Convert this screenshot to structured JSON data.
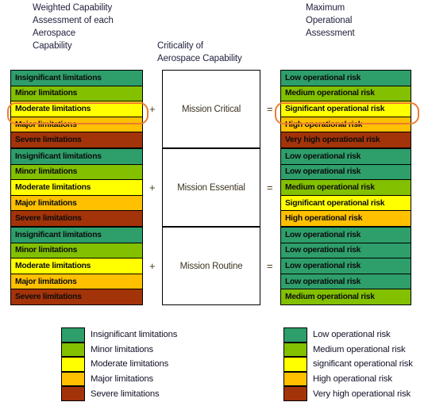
{
  "headings": {
    "left": "Weighted Capability\nAssessment of  each  Aerospace\nCapability",
    "middle": "Criticality of\nAerospace Capability",
    "right": "Maximum\nOperational\nAssessment"
  },
  "palette": {
    "green": "#2E9E6B",
    "yellow_green": "#82C000",
    "yellow": "#FFFF00",
    "amber": "#FFC000",
    "dark_red": "#A33309",
    "highlight_ring": "#ED7D31",
    "border": "#000000",
    "background": "#FFFFFF"
  },
  "operators": {
    "plus": "+",
    "equals": "="
  },
  "blocks": [
    {
      "criticality": "Mission Critical",
      "plus": "+",
      "equals": "=",
      "capability": [
        {
          "label": "Insignificant limitations",
          "color": "#2E9E6B"
        },
        {
          "label": "Minor limitations",
          "color": "#82C000"
        },
        {
          "label": "Moderate limitations",
          "color": "#FFFF00",
          "highlighted": true
        },
        {
          "label": "Major limitations",
          "color": "#FFC000"
        },
        {
          "label": "Severe limitations",
          "color": "#A33309"
        }
      ],
      "assessment": [
        {
          "label": "Low operational risk",
          "color": "#2E9E6B"
        },
        {
          "label": "Medium operational risk",
          "color": "#82C000"
        },
        {
          "label": "Significant operational risk",
          "color": "#FFFF00",
          "highlighted": true
        },
        {
          "label": "High operational risk",
          "color": "#FFC000"
        },
        {
          "label": "Very high operational risk",
          "color": "#A33309"
        }
      ]
    },
    {
      "criticality": "Mission Essential",
      "plus": "+",
      "equals": "=",
      "capability": [
        {
          "label": "Insignificant limitations",
          "color": "#2E9E6B"
        },
        {
          "label": "Minor limitations",
          "color": "#82C000"
        },
        {
          "label": "Moderate limitations",
          "color": "#FFFF00"
        },
        {
          "label": "Major limitations",
          "color": "#FFC000"
        },
        {
          "label": "Severe limitations",
          "color": "#A33309"
        }
      ],
      "assessment": [
        {
          "label": "Low operational risk",
          "color": "#2E9E6B"
        },
        {
          "label": "Low operational risk",
          "color": "#2E9E6B"
        },
        {
          "label": "Medium operational risk",
          "color": "#82C000"
        },
        {
          "label": "Significant operational risk",
          "color": "#FFFF00"
        },
        {
          "label": "High operational risk",
          "color": "#FFC000"
        }
      ]
    },
    {
      "criticality": "Mission Routine",
      "plus": "+",
      "equals": "=",
      "capability": [
        {
          "label": "Insignificant limitations",
          "color": "#2E9E6B"
        },
        {
          "label": "Minor limitations",
          "color": "#82C000"
        },
        {
          "label": "Moderate limitations",
          "color": "#FFFF00"
        },
        {
          "label": "Major limitations",
          "color": "#FFC000"
        },
        {
          "label": "Severe limitations",
          "color": "#A33309"
        }
      ],
      "assessment": [
        {
          "label": "Low operational risk",
          "color": "#2E9E6B"
        },
        {
          "label": "Low operational risk",
          "color": "#2E9E6B"
        },
        {
          "label": "Low operational risk",
          "color": "#2E9E6B"
        },
        {
          "label": "Low operational risk",
          "color": "#2E9E6B"
        },
        {
          "label": "Medium operational risk",
          "color": "#82C000"
        }
      ]
    }
  ],
  "legend_left": [
    {
      "label": "Insignificant limitations",
      "color": "#2E9E6B"
    },
    {
      "label": "Minor limitations",
      "color": "#82C000"
    },
    {
      "label": "Moderate limitations",
      "color": "#FFFF00"
    },
    {
      "label": "Major limitations",
      "color": "#FFC000"
    },
    {
      "label": "Severe limitations",
      "color": "#A33309"
    }
  ],
  "legend_right": [
    {
      "label": "Low operational risk",
      "color": "#2E9E6B"
    },
    {
      "label": "Medium operational risk",
      "color": "#82C000"
    },
    {
      "label": "significant operational risk",
      "color": "#FFFF00"
    },
    {
      "label": "High operational risk",
      "color": "#FFC000"
    },
    {
      "label": "Very high operational risk",
      "color": "#A33309"
    }
  ]
}
